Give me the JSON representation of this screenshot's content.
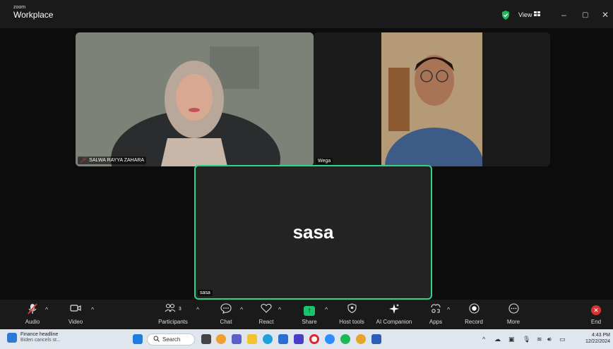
{
  "titlebar": {
    "brand_small": "zoom",
    "brand_big": "Workplace",
    "view_label": "View",
    "minimize": "–",
    "restore": "▢",
    "close": "✕"
  },
  "participants": {
    "tile1_name": "SALWA RAYYA ZAHARA",
    "tile2_name": "Wega",
    "tile3_name": "sasa",
    "tile3_big_name": "sasa"
  },
  "toolbar": {
    "audio": "Audio",
    "video": "Video",
    "participants_count": "3",
    "participants": "Participants",
    "chat": "Chat",
    "react": "React",
    "share": "Share",
    "host_tools": "Host tools",
    "ai_companion": "AI Companion",
    "apps": "Apps",
    "record": "Record",
    "more": "More",
    "end": "End"
  },
  "taskbar": {
    "news_title": "Finance headline",
    "news_sub": "Biden cancels st...",
    "search": "Search",
    "time": "4:43 PM",
    "date": "12/22/2024"
  },
  "colors": {
    "active_speaker": "#2fd38a",
    "share_green": "#19c46c",
    "end_red": "#d93232"
  }
}
